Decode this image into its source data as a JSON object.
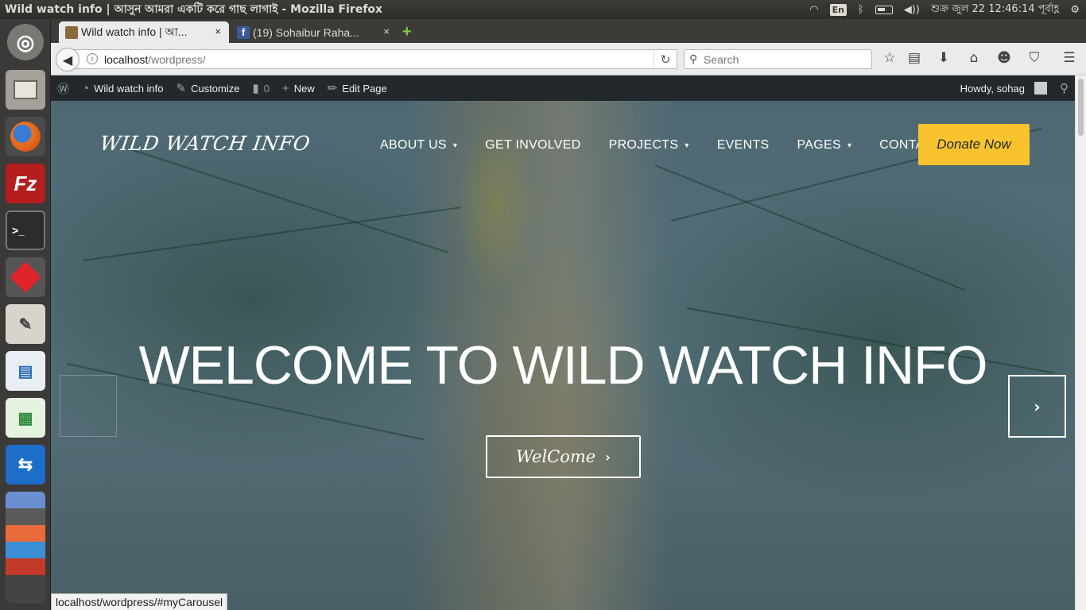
{
  "system": {
    "window_title": "Wild watch info | আসুন আমরা একটি করে গাছ লাগাই - Mozilla Firefox",
    "keyboard_layout": "En",
    "clock": "শুক্র জুল 22 12:46:14 পূর্বাহ্ণ"
  },
  "launcher": {
    "items": [
      "ubuntu-dash",
      "files",
      "firefox",
      "filezilla",
      "terminal",
      "red-app",
      "text-editor",
      "libreoffice-impress",
      "libreoffice-calc",
      "teamviewer",
      "stacked-apps"
    ]
  },
  "browser": {
    "tabs": [
      {
        "label": "Wild watch info | আ...",
        "close": "×"
      },
      {
        "label": "(19) Sohaibur Raha...",
        "close": "×"
      }
    ],
    "new_tab": "+",
    "url_host": "localhost",
    "url_path": "/wordpress/",
    "search_placeholder": "Search",
    "status_url": "localhost/wordpress/#myCarousel"
  },
  "adminbar": {
    "site": "Wild watch info",
    "customize": "Customize",
    "comments": "0",
    "new": "New",
    "edit": "Edit Page",
    "howdy": "Howdy, sohag"
  },
  "site": {
    "logo": "WILD WATCH INFO",
    "nav": [
      {
        "label": "ABOUT US",
        "caret": true
      },
      {
        "label": "GET INVOLVED",
        "caret": false
      },
      {
        "label": "PROJECTS",
        "caret": true
      },
      {
        "label": "EVENTS",
        "caret": false
      },
      {
        "label": "PAGES",
        "caret": true
      },
      {
        "label": "CONTACT",
        "caret": false
      }
    ],
    "donate": "Donate Now",
    "hero_title": "WELCOME TO WILD WATCH INFO",
    "hero_button": "WelCome",
    "next_arrow": "›"
  },
  "colors": {
    "donate_bg": "#f9c22e",
    "adminbar_bg": "#23282d",
    "ubuntu_panel": "#3c3b37"
  }
}
